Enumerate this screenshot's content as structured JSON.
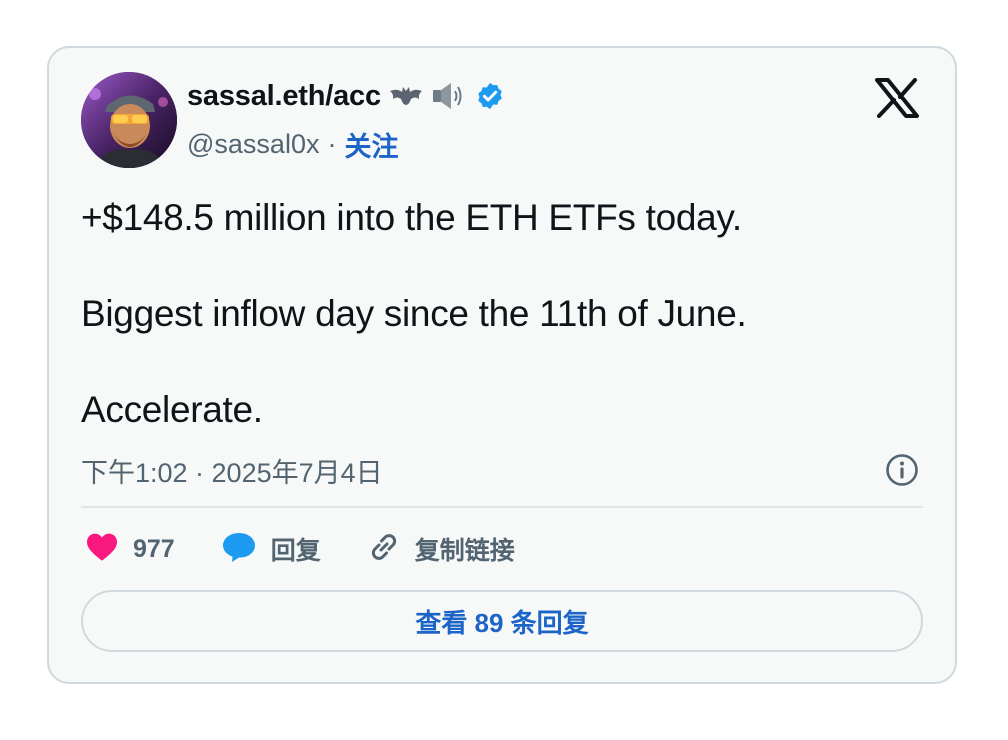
{
  "author": {
    "display_name": "sassal.eth/acc",
    "emojis": [
      "bat",
      "speaker"
    ],
    "handle": "@sassal0x",
    "separator": "·",
    "follow_label": "关注",
    "verified": true
  },
  "tweet": {
    "paragraphs": [
      "+$148.5 million into the ETH ETFs today.",
      "Biggest inflow day since the 11th of June.",
      "Accelerate."
    ],
    "timestamp": "下午1:02 · 2025年7月4日"
  },
  "actions": {
    "like_count": "977",
    "reply_label": "回复",
    "copy_link_label": "复制链接"
  },
  "replies_button_label": "查看 89 条回复",
  "icons": [
    "x-logo-icon",
    "verified-badge-icon",
    "info-icon",
    "heart-icon",
    "reply-bubble-icon",
    "link-icon"
  ],
  "colors": {
    "card_background": "#f7f9f9",
    "border": "#cfd9de",
    "text_primary": "#0f1419",
    "text_secondary": "#536471",
    "link_blue": "#1d64c8",
    "verified_blue": "#1d9bf0",
    "heart_pink": "#f91880"
  }
}
